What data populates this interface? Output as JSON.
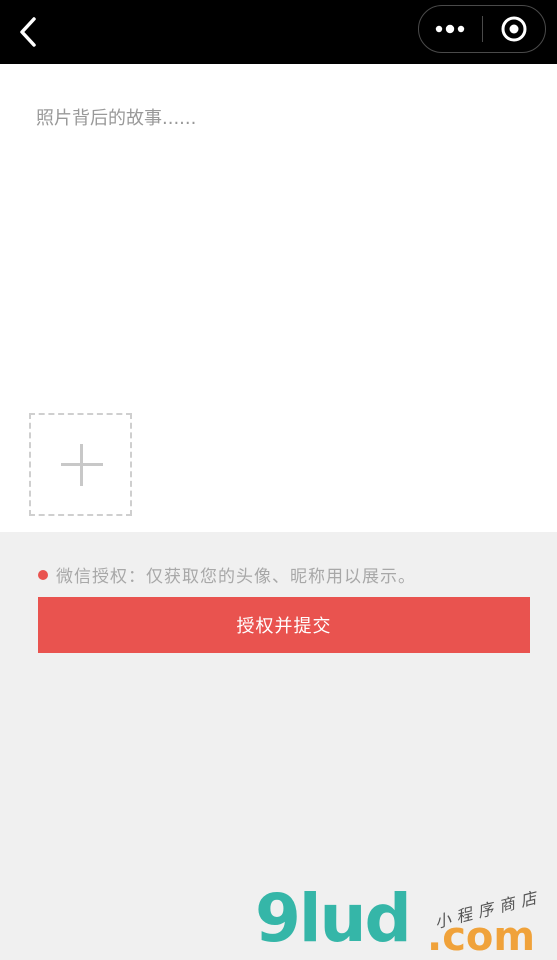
{
  "nav": {
    "back_icon": "chevron-left-icon",
    "more_icon": "more-dots-icon",
    "close_icon": "target-circle-icon"
  },
  "editor": {
    "placeholder": "照片背后的故事......",
    "add_icon": "plus-icon"
  },
  "notice": {
    "text": "微信授权：仅获取您的头像、昵称用以展示。",
    "dot_color": "#e9534f"
  },
  "submit": {
    "label": "授权并提交",
    "color": "#e9534f"
  },
  "watermark": {
    "main": "9lud",
    "dotcom": ".com",
    "sub": "小程序商店"
  }
}
